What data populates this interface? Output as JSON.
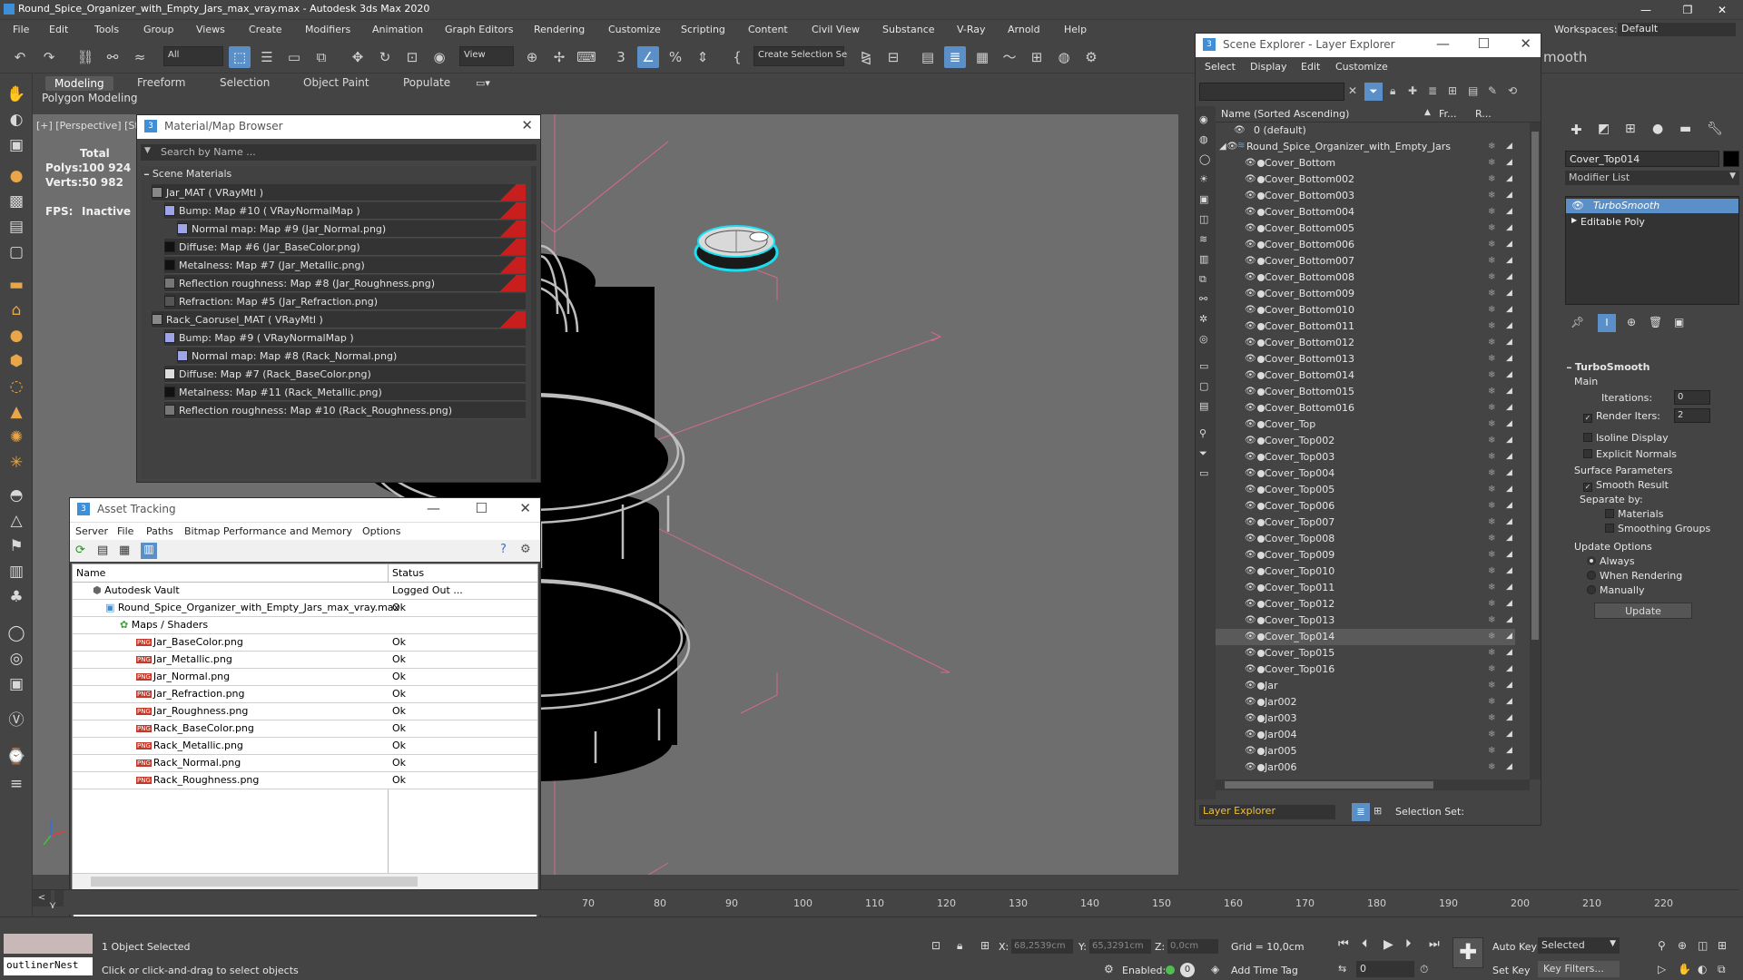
{
  "app": {
    "title": "Round_Spice_Organizer_with_Empty_Jars_max_vray.max - Autodesk 3ds Max 2020",
    "workspaces_label": "Workspaces:",
    "workspaces_value": "Default"
  },
  "menu": [
    "File",
    "Edit",
    "Tools",
    "Group",
    "Views",
    "Create",
    "Modifiers",
    "Animation",
    "Graph Editors",
    "Rendering",
    "Customize",
    "Scripting",
    "Content",
    "Civil View",
    "Substance",
    "V-Ray",
    "Arnold",
    "Help"
  ],
  "toolbar": {
    "filter_value": "All",
    "view_value": "View",
    "selection_set_value": "Create Selection Se"
  },
  "ribbon": {
    "tabs": [
      "Modeling",
      "Freeform",
      "Selection",
      "Object Paint",
      "Populate"
    ],
    "sub_label": "Polygon Modeling"
  },
  "viewport": {
    "label": "[+] [Perspective] [St",
    "stats_total": "Total",
    "polys_label": "Polys:",
    "polys_value": "100 924",
    "verts_label": "Verts:",
    "verts_value": "50 982",
    "fps_label": "FPS:",
    "fps_value": "Inactive"
  },
  "material_browser": {
    "title": "Material/Map Browser",
    "search_placeholder": "Search by Name ...",
    "section": "Scene Materials",
    "rows": [
      {
        "text": "Jar_MAT  ( VRayMtl )",
        "indent": 0
      },
      {
        "text": "Bump: Map #10  ( VRayNormalMap )",
        "indent": 1
      },
      {
        "text": "Normal map: Map #9 (Jar_Normal.png)",
        "indent": 2
      },
      {
        "text": "Diffuse: Map #6 (Jar_BaseColor.png)",
        "indent": 1
      },
      {
        "text": "Metalness: Map #7 (Jar_Metallic.png)",
        "indent": 1
      },
      {
        "text": "Reflection roughness: Map #8 (Jar_Roughness.png)",
        "indent": 1
      },
      {
        "text": "Refraction: Map #5 (Jar_Refraction.png)",
        "indent": 1
      },
      {
        "text": "Rack_Caorusel_MAT  ( VRayMtl )",
        "indent": 0
      },
      {
        "text": "Bump: Map #9  ( VRayNormalMap )",
        "indent": 1
      },
      {
        "text": "Normal map: Map #8 (Rack_Normal.png)",
        "indent": 2
      },
      {
        "text": "Diffuse: Map #7 (Rack_BaseColor.png)",
        "indent": 1
      },
      {
        "text": "Metalness: Map #11 (Rack_Metallic.png)",
        "indent": 1
      },
      {
        "text": "Reflection roughness: Map #10 (Rack_Roughness.png)",
        "indent": 1
      }
    ]
  },
  "asset_tracking": {
    "title": "Asset Tracking",
    "menu": [
      "Server",
      "File",
      "Paths",
      "Bitmap Performance and Memory",
      "Options"
    ],
    "col_name": "Name",
    "col_status": "Status",
    "rows": [
      {
        "name": "Autodesk Vault",
        "status": "Logged Out ...",
        "indent": 1
      },
      {
        "name": "Round_Spice_Organizer_with_Empty_Jars_max_vray.max",
        "status": "Ok",
        "indent": 2
      },
      {
        "name": "Maps / Shaders",
        "status": "",
        "indent": 3
      },
      {
        "name": "Jar_BaseColor.png",
        "status": "Ok",
        "indent": 4
      },
      {
        "name": "Jar_Metallic.png",
        "status": "Ok",
        "indent": 4
      },
      {
        "name": "Jar_Normal.png",
        "status": "Ok",
        "indent": 4
      },
      {
        "name": "Jar_Refraction.png",
        "status": "Ok",
        "indent": 4
      },
      {
        "name": "Jar_Roughness.png",
        "status": "Ok",
        "indent": 4
      },
      {
        "name": "Rack_BaseColor.png",
        "status": "Ok",
        "indent": 4
      },
      {
        "name": "Rack_Metallic.png",
        "status": "Ok",
        "indent": 4
      },
      {
        "name": "Rack_Normal.png",
        "status": "Ok",
        "indent": 4
      },
      {
        "name": "Rack_Roughness.png",
        "status": "Ok",
        "indent": 4
      }
    ]
  },
  "scene_explorer": {
    "title": "Scene Explorer - Layer Explorer",
    "menu": [
      "Select",
      "Display",
      "Edit",
      "Customize"
    ],
    "col_name": "Name (Sorted Ascending)",
    "col_fr": "Fr...",
    "col_r": "R...",
    "rows": [
      {
        "name": "0 (default)",
        "level": 0
      },
      {
        "name": "Round_Spice_Organizer_with_Empty_Jars",
        "level": 1
      },
      {
        "name": "Cover_Bottom",
        "level": 2
      },
      {
        "name": "Cover_Bottom002",
        "level": 2
      },
      {
        "name": "Cover_Bottom003",
        "level": 2
      },
      {
        "name": "Cover_Bottom004",
        "level": 2
      },
      {
        "name": "Cover_Bottom005",
        "level": 2
      },
      {
        "name": "Cover_Bottom006",
        "level": 2
      },
      {
        "name": "Cover_Bottom007",
        "level": 2
      },
      {
        "name": "Cover_Bottom008",
        "level": 2
      },
      {
        "name": "Cover_Bottom009",
        "level": 2
      },
      {
        "name": "Cover_Bottom010",
        "level": 2
      },
      {
        "name": "Cover_Bottom011",
        "level": 2
      },
      {
        "name": "Cover_Bottom012",
        "level": 2
      },
      {
        "name": "Cover_Bottom013",
        "level": 2
      },
      {
        "name": "Cover_Bottom014",
        "level": 2
      },
      {
        "name": "Cover_Bottom015",
        "level": 2
      },
      {
        "name": "Cover_Bottom016",
        "level": 2
      },
      {
        "name": "Cover_Top",
        "level": 2
      },
      {
        "name": "Cover_Top002",
        "level": 2
      },
      {
        "name": "Cover_Top003",
        "level": 2
      },
      {
        "name": "Cover_Top004",
        "level": 2
      },
      {
        "name": "Cover_Top005",
        "level": 2
      },
      {
        "name": "Cover_Top006",
        "level": 2
      },
      {
        "name": "Cover_Top007",
        "level": 2
      },
      {
        "name": "Cover_Top008",
        "level": 2
      },
      {
        "name": "Cover_Top009",
        "level": 2
      },
      {
        "name": "Cover_Top010",
        "level": 2
      },
      {
        "name": "Cover_Top011",
        "level": 2
      },
      {
        "name": "Cover_Top012",
        "level": 2
      },
      {
        "name": "Cover_Top013",
        "level": 2
      },
      {
        "name": "Cover_Top014",
        "level": 2,
        "selected": true
      },
      {
        "name": "Cover_Top015",
        "level": 2
      },
      {
        "name": "Cover_Top016",
        "level": 2
      },
      {
        "name": "Jar",
        "level": 2
      },
      {
        "name": "Jar002",
        "level": 2
      },
      {
        "name": "Jar003",
        "level": 2
      },
      {
        "name": "Jar004",
        "level": 2
      },
      {
        "name": "Jar005",
        "level": 2
      },
      {
        "name": "Jar006",
        "level": 2
      }
    ],
    "footer_layer": "Layer Explorer",
    "footer_selset": "Selection Set:"
  },
  "command_panel": {
    "object_name": "Cover_Top014",
    "modifier_list": "Modifier List",
    "stack": [
      "TurboSmooth",
      "Editable Poly"
    ],
    "rollout_title": "TurboSmooth",
    "main_label": "Main",
    "iterations_label": "Iterations:",
    "iterations_value": "0",
    "render_iters_label": "Render Iters:",
    "render_iters_value": "2",
    "isoline_label": "Isoline Display",
    "explicit_label": "Explicit Normals",
    "surface_label": "Surface Parameters",
    "smooth_result_label": "Smooth Result",
    "separate_label": "Separate by:",
    "materials_label": "Materials",
    "smoothing_groups_label": "Smoothing Groups",
    "update_options_label": "Update Options",
    "always_label": "Always",
    "when_rendering_label": "When Rendering",
    "manually_label": "Manually",
    "update_button": "Update",
    "smooth_side": "mooth"
  },
  "timeline": {
    "ticks": [
      "70",
      "80",
      "90",
      "100",
      "110",
      "120",
      "130",
      "140",
      "150",
      "160",
      "170",
      "180",
      "190",
      "200",
      "210",
      "220"
    ]
  },
  "status": {
    "script_input": "outlinerNest",
    "selected_text": "1 Object Selected",
    "prompt_text": "Click or click-and-drag to select objects",
    "x_label": "X:",
    "x_value": "68,2539cm",
    "y_label": "Y:",
    "y_value": "65,3291cm",
    "z_label": "Z:",
    "z_value": "0,0cm",
    "grid": "Grid = 10,0cm",
    "enabled_label": "Enabled:",
    "add_time_tag": "Add Time Tag",
    "auto_key": "Auto Key",
    "selected_dropdown": "Selected",
    "set_key": "Set Key",
    "key_filters": "Key Filters...",
    "frame_value": "0"
  }
}
